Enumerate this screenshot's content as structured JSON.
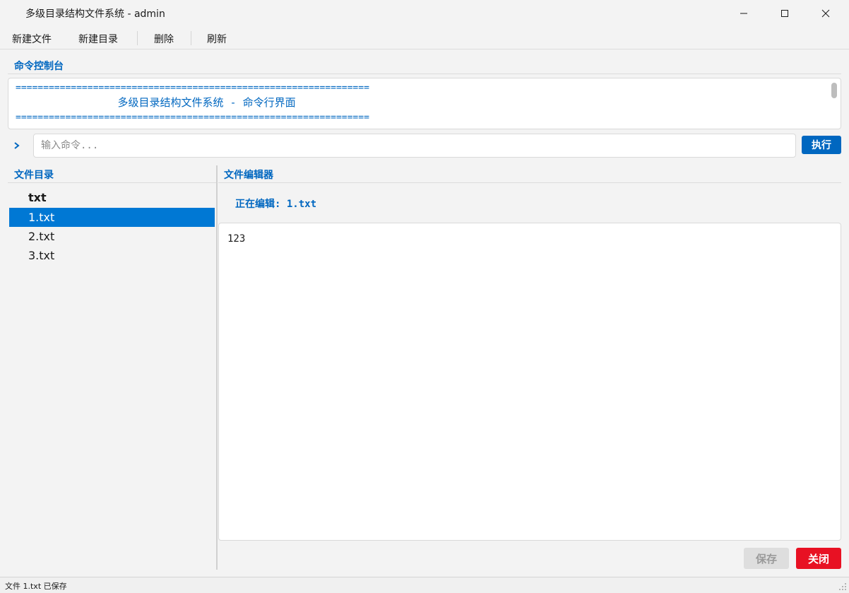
{
  "window": {
    "title": "多级目录结构文件系统 - admin"
  },
  "menu": {
    "items": [
      "新建文件",
      "新建目录",
      "删除",
      "刷新"
    ]
  },
  "console": {
    "label": "命令控制台",
    "lines": [
      "================================================================",
      "                多级目录结构文件系统 - 命令行界面",
      "================================================================"
    ],
    "prompt": ">",
    "input_value": "",
    "input_placeholder": "输入命令...",
    "execute_label": "执行"
  },
  "tree": {
    "label": "文件目录",
    "items": [
      {
        "name": "txt",
        "kind": "folder"
      },
      {
        "name": "1.txt",
        "kind": "file",
        "selected": true
      },
      {
        "name": "2.txt",
        "kind": "file"
      },
      {
        "name": "3.txt",
        "kind": "file"
      }
    ]
  },
  "editor": {
    "label": "文件编辑器",
    "editing_label": "正在编辑: 1.txt",
    "content": "123",
    "save_label": "保存",
    "close_label": "关闭"
  },
  "status": {
    "text": "文件 1.txt 已保存"
  },
  "colors": {
    "accent": "#0067c0",
    "selection": "#0078d4",
    "danger": "#e81123"
  },
  "icons": [
    "app-icon",
    "minimize-icon",
    "maximize-icon",
    "close-icon",
    "prompt-chevron-icon",
    "resize-grip-icon"
  ]
}
